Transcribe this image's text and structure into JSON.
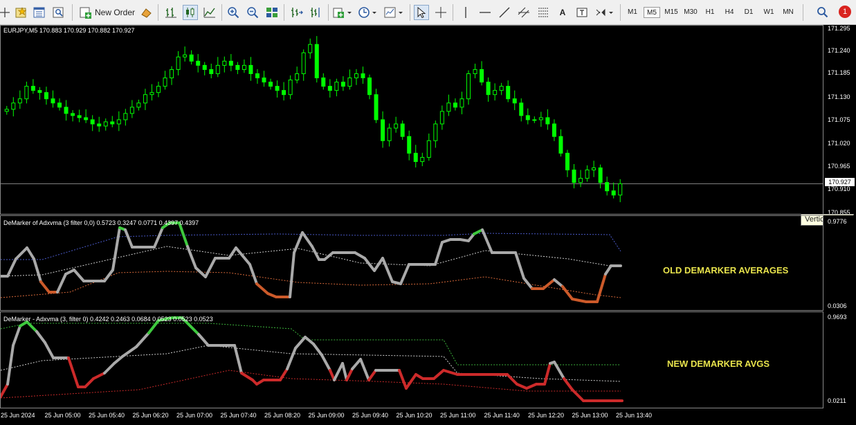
{
  "toolbar": {
    "new_order_label": "New Order",
    "timeframes": [
      "M1",
      "M5",
      "M15",
      "M30",
      "H1",
      "H4",
      "D1",
      "W1",
      "MN"
    ],
    "active_timeframe": "M5",
    "notification_count": "1"
  },
  "main_chart": {
    "title": "EURJPY,M5  170.883 170.929 170.882 170.927",
    "current_price": "170.927",
    "price_ticks": [
      "171.295",
      "171.240",
      "171.185",
      "171.130",
      "171.075",
      "171.020",
      "170.965",
      "170.910",
      "170.855"
    ],
    "tooltip": "Vertical scale"
  },
  "indicator1": {
    "title": "DeMarker of Adxvma (3 filter 0,0) 0.5723 0.3247 0.0771 0.4397 0.4397",
    "max_label": "0.9776",
    "min_label": "0.0306",
    "caption": "OLD DEMARKER AVERAGES"
  },
  "indicator2": {
    "title": "DeMarker - Adxvma (3, filter 0) 0.4242 0.2463 0.0684 0.0523 0.0523 0.0523",
    "max_label": "0.9693",
    "min_label": "0.0211",
    "caption": "NEW DEMARKER AVGS"
  },
  "time_axis": [
    "25 Jun 2024",
    "25 Jun 05:00",
    "25 Jun 05:40",
    "25 Jun 06:20",
    "25 Jun 07:00",
    "25 Jun 07:40",
    "25 Jun 08:20",
    "25 Jun 09:00",
    "25 Jun 09:40",
    "25 Jun 10:20",
    "25 Jun 11:00",
    "25 Jun 11:40",
    "25 Jun 12:20",
    "25 Jun 13:00",
    "25 Jun 13:40"
  ],
  "colors": {
    "bull": "#00ff00",
    "bear": "#00ff00",
    "bg": "#000000",
    "grid": "#8a8a8a",
    "indicator_line": "#a9a9a9",
    "indicator_up": "#3ec93e",
    "indicator_down_old": "#cc5a2a",
    "indicator_down_new": "#cc2a2a",
    "caption": "#e8e34c"
  }
}
